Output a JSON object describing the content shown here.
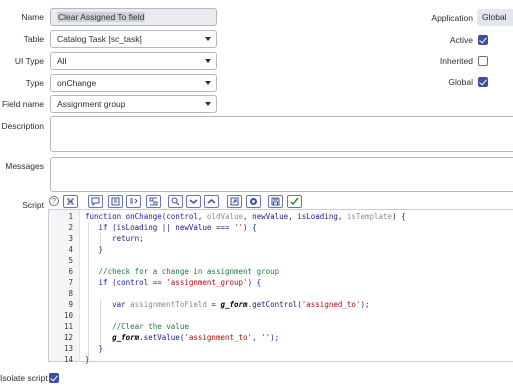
{
  "form": {
    "name_label": "Name",
    "name_value": "Clear Assigned To field",
    "table_label": "Table",
    "table_value": "Catalog Task [sc_task]",
    "ui_type_label": "UI Type",
    "ui_type_value": "All",
    "type_label": "Type",
    "type_value": "onChange",
    "field_name_label": "Field name",
    "field_name_value": "Assignment group",
    "description_label": "Description",
    "messages_label": "Messages",
    "script_label": "Script",
    "isolate_label": "Isolate script",
    "isolate_checked": true
  },
  "right": {
    "application_label": "Application",
    "application_value": "Global",
    "active_label": "Active",
    "active_checked": true,
    "inherited_label": "Inherited",
    "inherited_checked": false,
    "global_label": "Global",
    "global_checked": true
  },
  "toolbar": {
    "help_glyph": "?",
    "buttons": [
      "script-include-icon",
      "comment-icon",
      "format-icon",
      "replace-icon",
      "replace-all-icon",
      "search-icon",
      "expand-icon",
      "collapse-icon",
      "fullscreen-icon",
      "debug-icon",
      "save-icon",
      "syntax-check-icon"
    ]
  },
  "code": {
    "line_numbers": [
      "1",
      "2",
      "3",
      "4",
      "5",
      "6",
      "7",
      "8",
      "9",
      "10",
      "11",
      "12",
      "13",
      "14"
    ]
  },
  "colors": {
    "accent": "#3f4fa0",
    "keyword": "#1a1aa6",
    "comment": "#1f7a3a",
    "string": "#aa1111"
  }
}
